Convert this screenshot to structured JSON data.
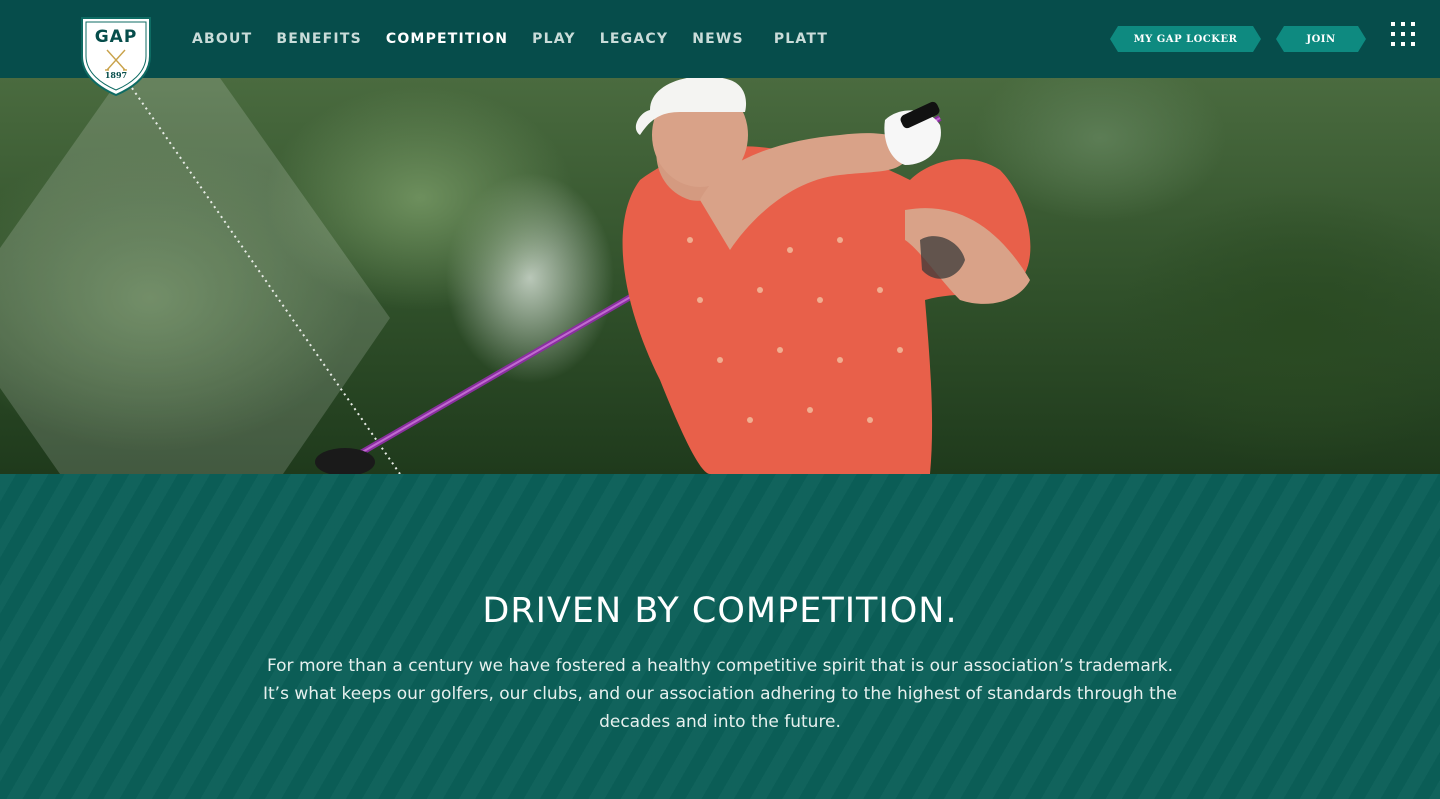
{
  "logo": {
    "text": "GAP",
    "year": "1897"
  },
  "nav": {
    "items": [
      {
        "label": "ABOUT"
      },
      {
        "label": "BENEFITS"
      },
      {
        "label": "COMPETITION"
      },
      {
        "label": "PLAY"
      },
      {
        "label": "LEGACY"
      },
      {
        "label": "NEWS"
      },
      {
        "label": "PLATT"
      }
    ],
    "active": "COMPETITION"
  },
  "header_buttons": {
    "locker_label": "MY GAP LOCKER",
    "join_label": "JOIN"
  },
  "icons": {
    "menu": "grid-menu-icon",
    "logo_crest": "crossed-golf-clubs-icon"
  },
  "colors": {
    "header_bg": "#064d4b",
    "accent": "#0e8a80",
    "content_bg": "#0b5f58",
    "shirt": "#e8604a"
  },
  "content": {
    "title": "DRIVEN BY COMPETITION.",
    "body": "For more than a century we have fostered a healthy competitive spirit that is our association’s trademark. It’s what keeps our golfers, our clubs, and our association adhering to the highest of standards through the decades and into the future."
  }
}
